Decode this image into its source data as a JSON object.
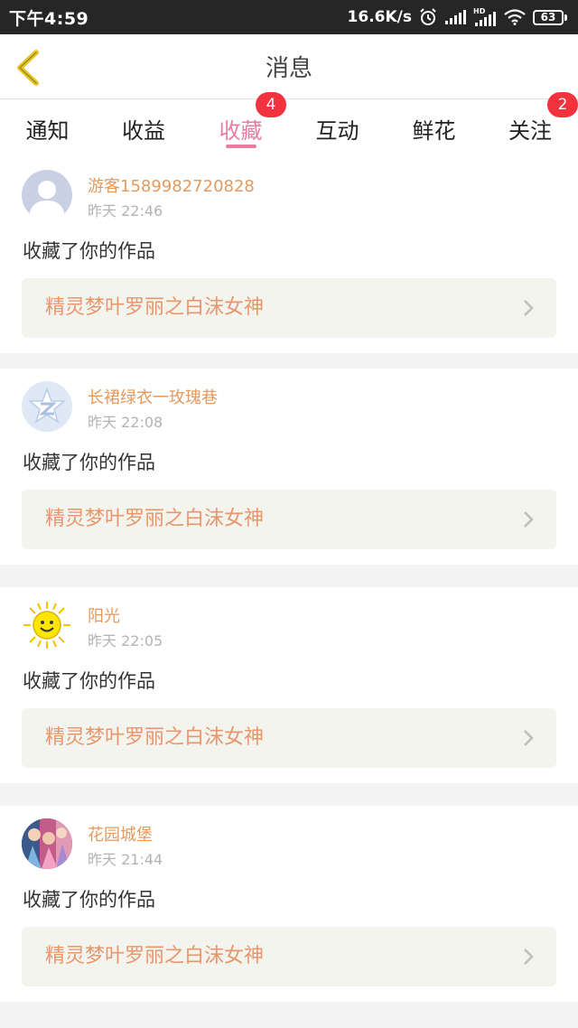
{
  "status_bar": {
    "time": "下午4:59",
    "net_speed": "16.6K/s",
    "battery": "63"
  },
  "header": {
    "title": "消息"
  },
  "tabs": [
    {
      "label": "通知",
      "badge": ""
    },
    {
      "label": "收益",
      "badge": ""
    },
    {
      "label": "收藏",
      "badge": "4",
      "active": true
    },
    {
      "label": "互动",
      "badge": ""
    },
    {
      "label": "鲜花",
      "badge": ""
    },
    {
      "label": "关注",
      "badge": "2"
    }
  ],
  "messages": [
    {
      "user": "游客1589982720828",
      "time": "昨天 22:46",
      "action": "收藏了你的作品",
      "work_title": "精灵梦叶罗丽之白沫女神",
      "avatar": "default-user-icon"
    },
    {
      "user": "长裙绿衣一玫瑰巷",
      "time": "昨天 22:08",
      "action": "收藏了你的作品",
      "work_title": "精灵梦叶罗丽之白沫女神",
      "avatar": "qq-logo-icon"
    },
    {
      "user": "阳光",
      "time": "昨天 22:05",
      "action": "收藏了你的作品",
      "work_title": "精灵梦叶罗丽之白沫女神",
      "avatar": "sun-icon"
    },
    {
      "user": "花园城堡",
      "time": "昨天 21:44",
      "action": "收藏了你的作品",
      "work_title": "精灵梦叶罗丽之白沫女神",
      "avatar": "photo-avatar"
    }
  ],
  "colors": {
    "accent": "#e57fa2",
    "username": "#e39a5f",
    "badge": "#f2333e",
    "work_title": "#e8966b"
  }
}
